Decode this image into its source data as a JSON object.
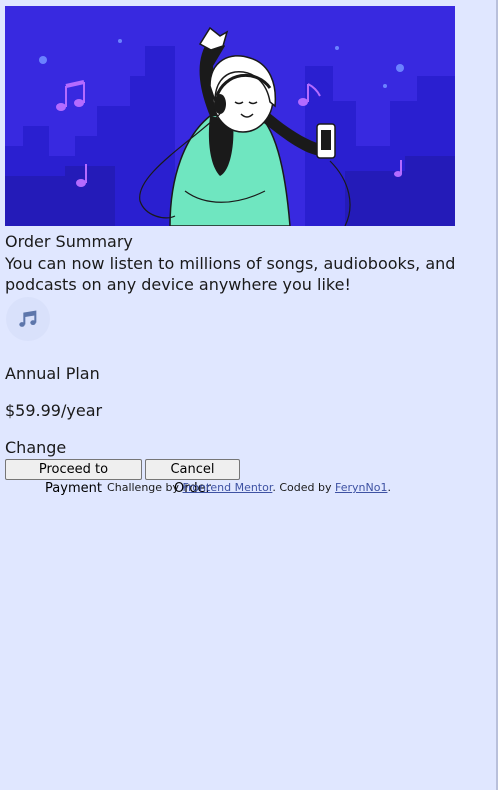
{
  "hero": {
    "alt": "illustration-hero"
  },
  "card": {
    "title": "Order Summary",
    "description": "You can now listen to millions of songs, audiobooks, and podcasts on any device anywhere you like!",
    "plan_name": "Annual Plan",
    "plan_price": "$59.99/year",
    "change_label": "Change",
    "pay_button": "Proceed to Payment",
    "cancel_button": "Cancel Order"
  },
  "attribution": {
    "prefix": "Challenge by ",
    "link1": "Frontend Mentor",
    "middle": ". Coded by ",
    "link2": "FerynNo1",
    "suffix": "."
  },
  "colors": {
    "page_bg": "#e0e7ff",
    "hero_bg": "#3829e0",
    "accent": "#5d76ab",
    "link": "#3e52a3"
  },
  "icons": [
    "music-note-icon"
  ]
}
